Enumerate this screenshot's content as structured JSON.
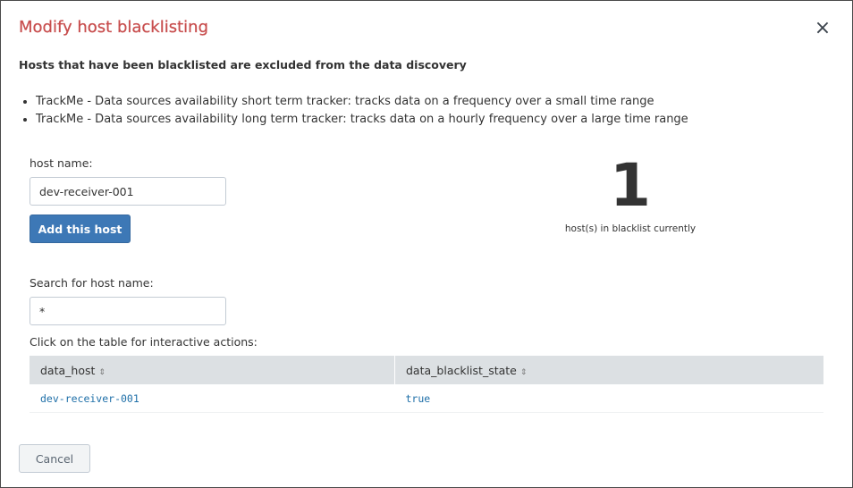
{
  "modal": {
    "title": "Modify host blacklisting",
    "close_glyph": "×",
    "subtitle": "Hosts that have been blacklisted are excluded from the data discovery",
    "bullets": [
      "TrackMe - Data sources availability short term tracker: tracks data on a frequency over a small time range",
      "TrackMe - Data sources availability long term tracker: tracks data on a hourly frequency over a large time range"
    ]
  },
  "add_form": {
    "label": "host name:",
    "value": "dev-receiver-001",
    "button_label": "Add this host"
  },
  "counter": {
    "value": "1",
    "caption": "host(s) in blacklist currently"
  },
  "search": {
    "label": "Search for host name:",
    "value": "*",
    "table_hint": "Click on the table for interactive actions:"
  },
  "table": {
    "columns": [
      "data_host",
      "data_blacklist_state"
    ],
    "sort_glyph": "⇕",
    "rows": [
      [
        "dev-receiver-001",
        "true"
      ]
    ]
  },
  "footer": {
    "cancel_label": "Cancel"
  },
  "colors": {
    "title": "#c84e4e",
    "primary_button": "#3d78b6",
    "link": "#1e6fa8",
    "table_header": "#dce0e3"
  }
}
